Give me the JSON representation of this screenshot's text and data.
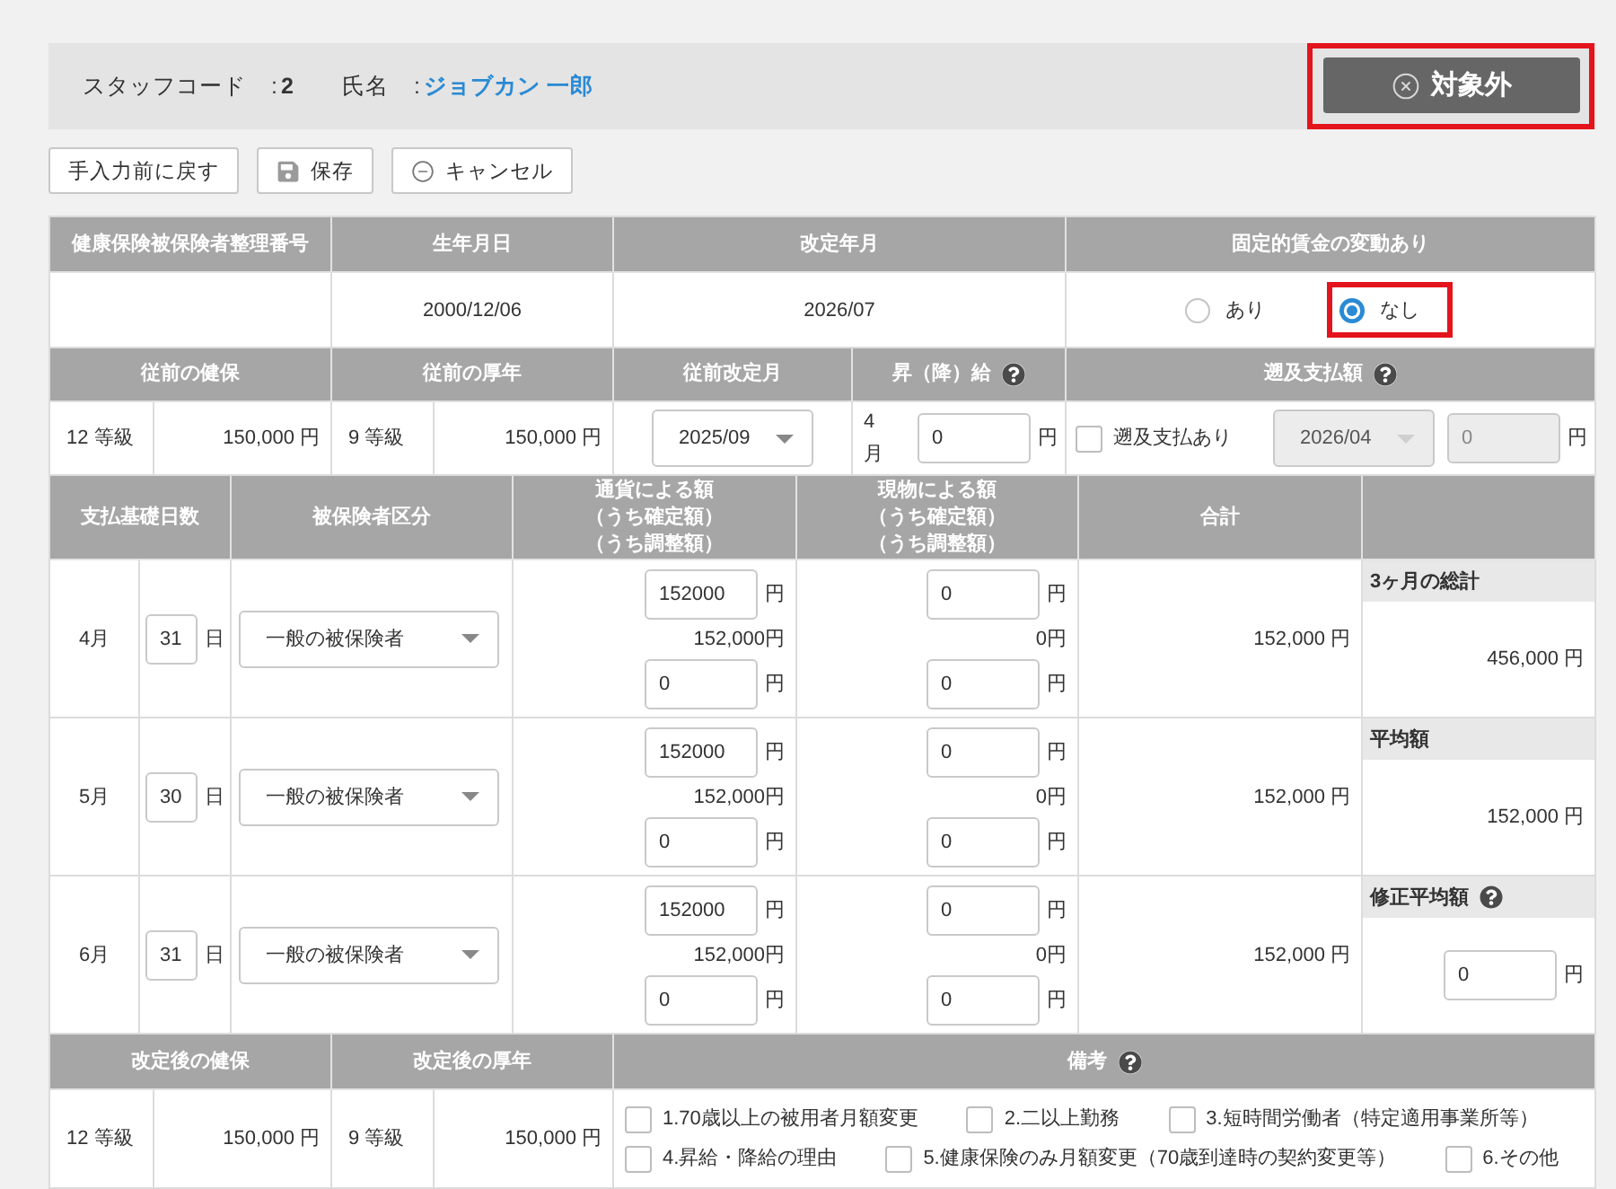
{
  "info_bar": {
    "fields": [
      {
        "label": "スタッフコード",
        "colon": ":",
        "value": "2",
        "kind": "text"
      },
      {
        "label": "氏名",
        "colon": ":",
        "value": "ジョブカン 一郎",
        "kind": "link"
      }
    ],
    "exclude_button": {
      "label": "対象外",
      "highlighted": true
    }
  },
  "actions": [
    {
      "label": "手入力前に戻す",
      "kind": "plain"
    },
    {
      "label": "保存",
      "kind": "save"
    },
    {
      "label": "キャンセル",
      "kind": "cancel"
    }
  ],
  "basic": {
    "columns": [
      {
        "label": "健康保険被保険者整理番号",
        "help": false
      },
      {
        "label": "生年月日",
        "help": false
      },
      {
        "label": "改定年月",
        "help": false
      },
      {
        "label": "固定的賃金の変動あり",
        "help": false
      }
    ],
    "birth_date": "2000/12/06",
    "revision_month": "2026/07",
    "fixed_wage_change": [
      {
        "label": "あり",
        "selected": false,
        "highlighted": false
      },
      {
        "label": "なし",
        "selected": true,
        "highlighted": true
      }
    ]
  },
  "previous": {
    "columns": [
      {
        "label": "従前の健保",
        "help": false
      },
      {
        "label": "従前の厚年",
        "help": false
      },
      {
        "label": "従前改定月",
        "help": false
      },
      {
        "label": "昇（降）給",
        "help": true
      },
      {
        "label": "遡及支払額",
        "help": true
      }
    ],
    "health": {
      "grade": "12 等級",
      "amount": "150,000 円"
    },
    "pension": {
      "grade": "9 等級",
      "amount": "150,000 円"
    },
    "revision_month": {
      "value": "2025/09",
      "disabled": false
    },
    "raise": {
      "month": "4月",
      "value": "0",
      "unit": "円"
    },
    "retro": {
      "label": "遡及支払あり",
      "checked": false,
      "month": {
        "value": "2026/04",
        "disabled": true
      },
      "amount": {
        "value": "0",
        "unit": "円",
        "disabled": true
      }
    }
  },
  "months": {
    "columns": [
      {
        "lines": [
          "支払基礎日数"
        ]
      },
      {
        "lines": [
          "被保険者区分"
        ]
      },
      {
        "lines": [
          "通貨による額",
          "（うち確定額）",
          "（うち調整額）"
        ]
      },
      {
        "lines": [
          "現物による額",
          "（うち確定額）",
          "（うち調整額）"
        ]
      },
      {
        "lines": [
          "合計"
        ]
      }
    ],
    "rows": [
      {
        "month": "4月",
        "days": {
          "value": "31",
          "unit": "日"
        },
        "category": "一般の被保険者",
        "cash": {
          "amount": {
            "value": "152000",
            "unit": "円"
          },
          "fixed": "152,000円",
          "adjustment": {
            "value": "0",
            "unit": "円"
          }
        },
        "in_kind": {
          "amount": {
            "value": "0",
            "unit": "円"
          },
          "fixed": "0円",
          "adjustment": {
            "value": "0",
            "unit": "円"
          }
        },
        "total": "152,000 円"
      },
      {
        "month": "5月",
        "days": {
          "value": "30",
          "unit": "日"
        },
        "category": "一般の被保険者",
        "cash": {
          "amount": {
            "value": "152000",
            "unit": "円"
          },
          "fixed": "152,000円",
          "adjustment": {
            "value": "0",
            "unit": "円"
          }
        },
        "in_kind": {
          "amount": {
            "value": "0",
            "unit": "円"
          },
          "fixed": "0円",
          "adjustment": {
            "value": "0",
            "unit": "円"
          }
        },
        "total": "152,000 円"
      },
      {
        "month": "6月",
        "days": {
          "value": "31",
          "unit": "日"
        },
        "category": "一般の被保険者",
        "cash": {
          "amount": {
            "value": "152000",
            "unit": "円"
          },
          "fixed": "152,000円",
          "adjustment": {
            "value": "0",
            "unit": "円"
          }
        },
        "in_kind": {
          "amount": {
            "value": "0",
            "unit": "円"
          },
          "fixed": "0円",
          "adjustment": {
            "value": "0",
            "unit": "円"
          }
        },
        "total": "152,000 円"
      }
    ],
    "summary": [
      {
        "kind": "text",
        "label": "3ヶ月の総計",
        "help": false,
        "value": "456,000 円"
      },
      {
        "kind": "text",
        "label": "平均額",
        "help": false,
        "value": "152,000 円"
      },
      {
        "kind": "input",
        "label": "修正平均額",
        "help": true,
        "value": "0",
        "unit": "円"
      }
    ]
  },
  "after": {
    "columns": [
      {
        "label": "改定後の健保",
        "help": false
      },
      {
        "label": "改定後の厚年",
        "help": false
      },
      {
        "label": "備考",
        "help": true
      }
    ],
    "health": {
      "grade": "12 等級",
      "amount": "150,000 円"
    },
    "pension": {
      "grade": "9 等級",
      "amount": "150,000 円"
    },
    "remarks": [
      {
        "label": "1.70歳以上の被用者月額変更",
        "checked": false
      },
      {
        "label": "2.二以上勤務",
        "checked": false
      },
      {
        "label": "3.短時間労働者（特定適用事業所等）",
        "checked": false
      },
      {
        "label": "4.昇給・降給の理由",
        "checked": false
      },
      {
        "label": "5.健康保険のみ月額変更（70歳到達時の契約変更等）",
        "checked": false
      },
      {
        "label": "6.その他",
        "checked": false
      }
    ]
  }
}
